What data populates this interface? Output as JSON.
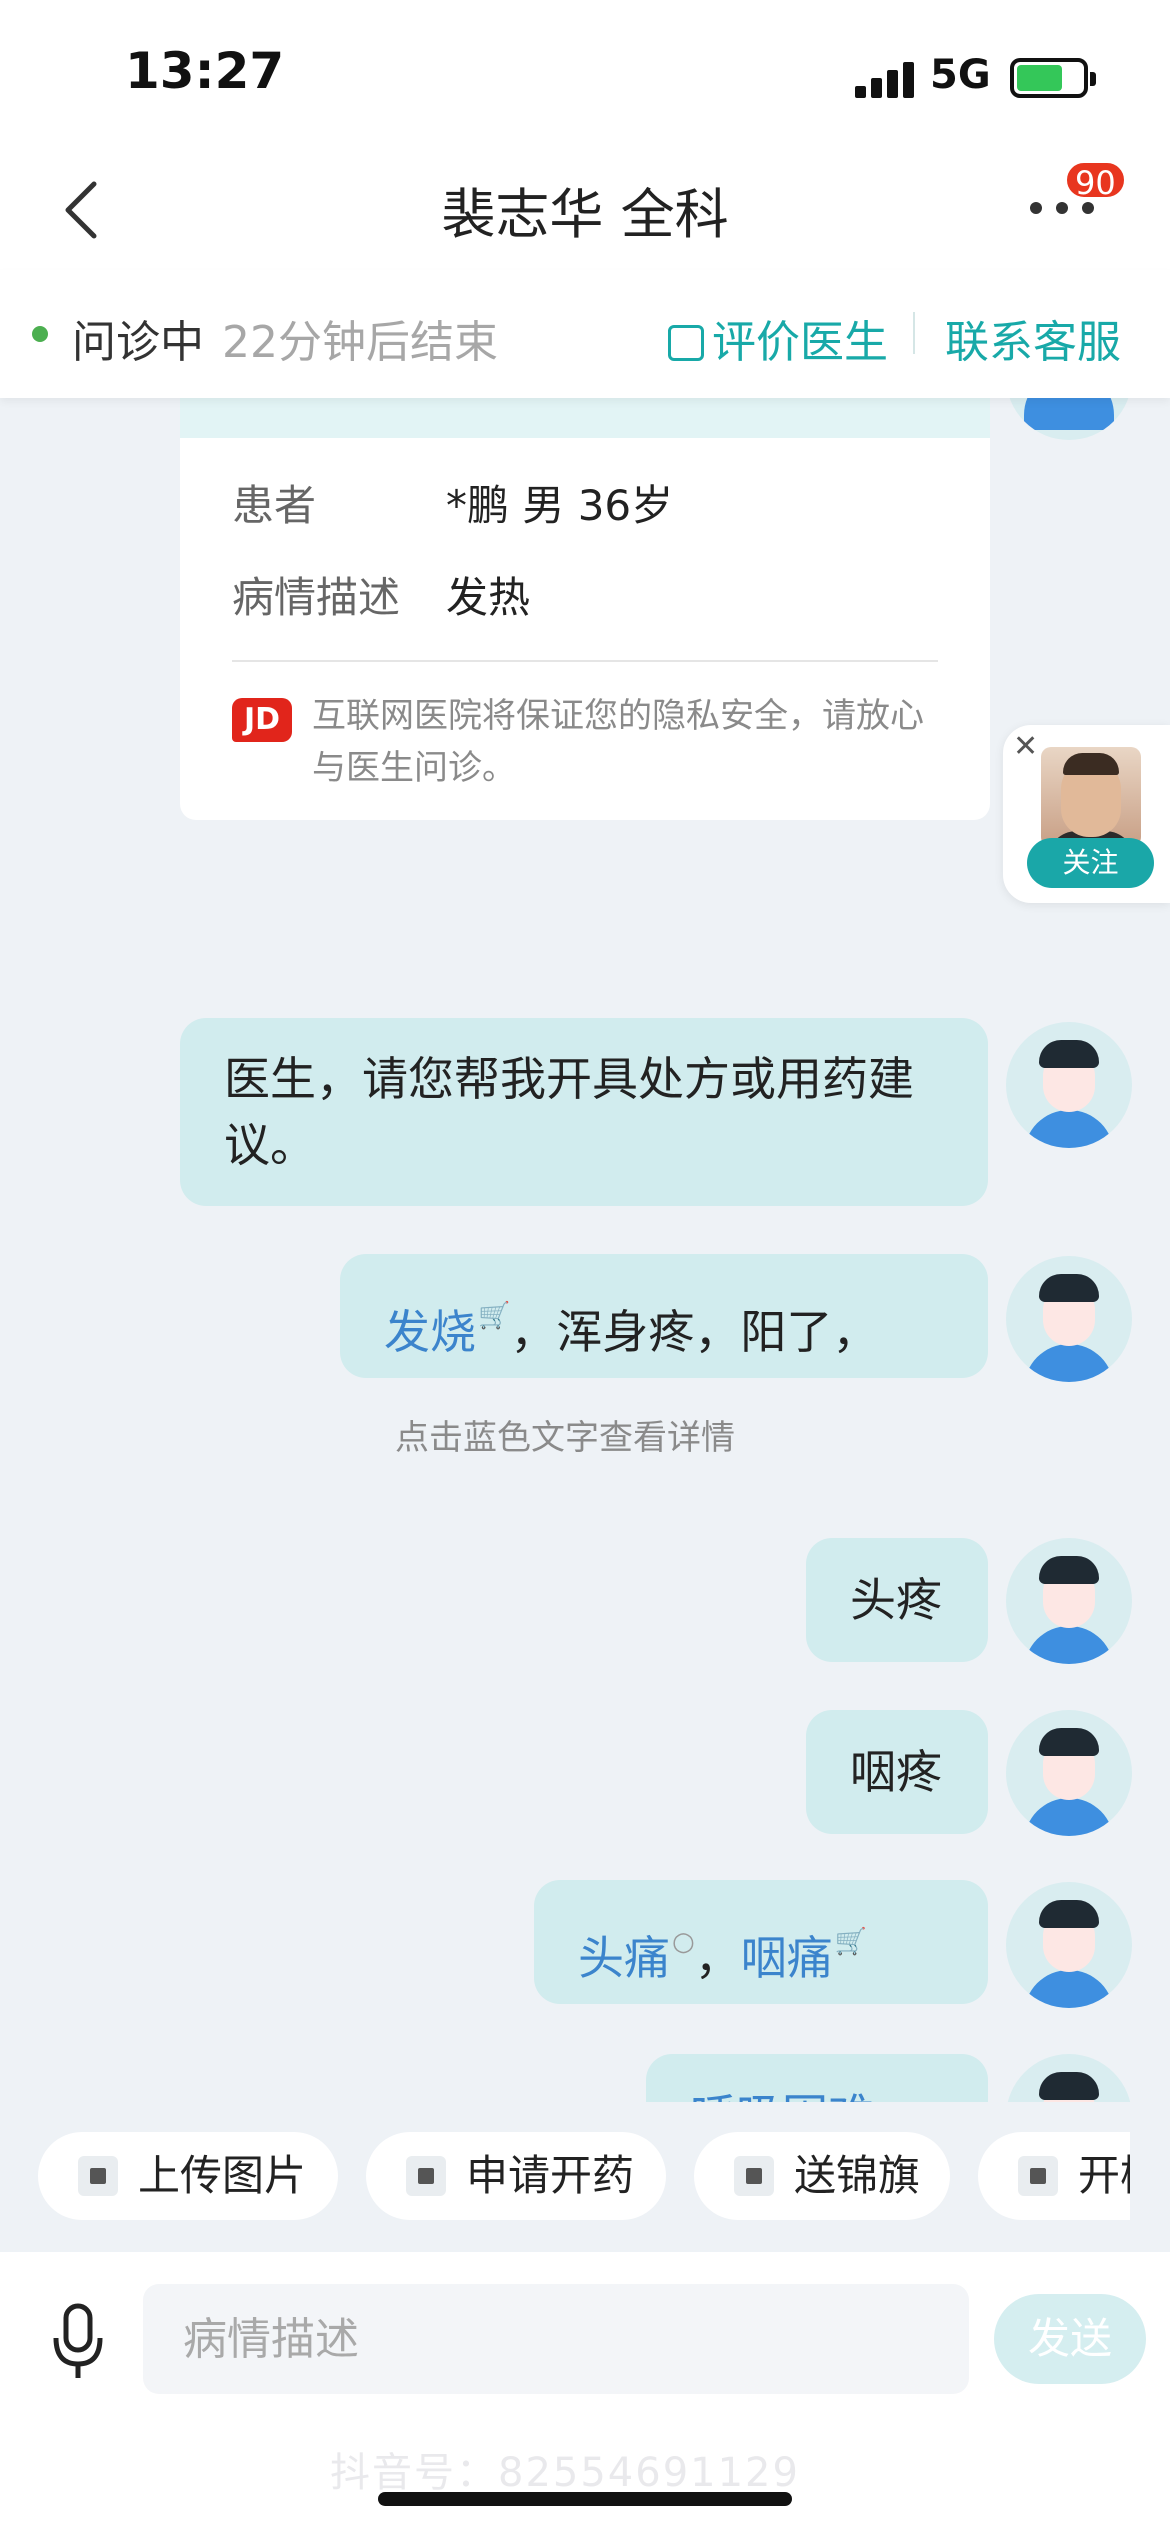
{
  "status_bar": {
    "time": "13:27",
    "network": "5G"
  },
  "nav": {
    "title": "裴志华 全科",
    "badge": "90"
  },
  "consult": {
    "status": "问诊中",
    "timer": "22分钟后结束",
    "rate_label": "评价医生",
    "contact_label": "联系客服"
  },
  "info_card": {
    "patient_label": "患者",
    "patient_value": "*鹏 男 36岁",
    "desc_label": "病情描述",
    "desc_value": "发热",
    "jd_logo": "JD",
    "privacy_note": "互联网医院将保证您的隐私安全，请放心与医生问诊。"
  },
  "follow": {
    "label": "关注"
  },
  "messages": {
    "m1": "医生，请您帮我开具处方或用药建议。",
    "m2_link": "发烧",
    "m2_rest": "，浑身疼，阳了，",
    "hint": "点击蓝色文字查看详情",
    "m3": "头疼",
    "m4": "咽疼",
    "m5_link1": "头痛",
    "m5_sep": "，",
    "m5_link2": "咽痛",
    "m6_partial": "呼吸困难"
  },
  "quick_actions": [
    "上传图片",
    "申请开药",
    "送锦旗",
    "开检查单"
  ],
  "input": {
    "placeholder": "病情描述",
    "send_label": "发送"
  },
  "watermark": "抖音号：82554691129",
  "colors": {
    "accent": "#18a9a8",
    "bubble": "#d1ecee",
    "link": "#3b84cc",
    "badge": "#e8361f"
  }
}
